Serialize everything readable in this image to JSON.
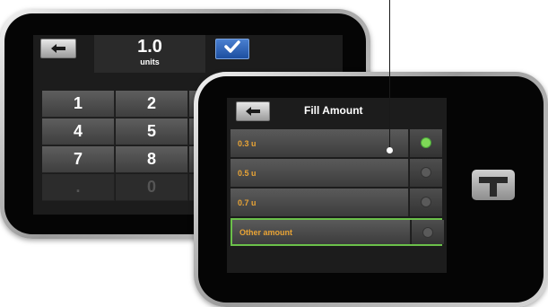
{
  "units_screen": {
    "value": "1.0",
    "unit_label": "units",
    "keypad": [
      {
        "label": "1",
        "dim": false
      },
      {
        "label": "2",
        "dim": false
      },
      {
        "label": "4",
        "dim": false
      },
      {
        "label": "5",
        "dim": false
      },
      {
        "label": "7",
        "dim": false
      },
      {
        "label": "8",
        "dim": false
      },
      {
        "label": ".",
        "dim": true
      },
      {
        "label": "0",
        "dim": true
      }
    ]
  },
  "fill_screen": {
    "title": "Fill Amount",
    "options": [
      {
        "label": "0.3 u",
        "selected": true,
        "highlighted": false
      },
      {
        "label": "0.5 u",
        "selected": false,
        "highlighted": false
      },
      {
        "label": "0.7 u",
        "selected": false,
        "highlighted": false
      },
      {
        "label": "Other amount",
        "selected": false,
        "highlighted": true
      }
    ]
  },
  "icons": {
    "back": "back-arrow-icon",
    "confirm": "checkmark-icon",
    "brand": "t-logo-icon"
  },
  "colors": {
    "option_text": "#e8a335",
    "selected_radio": "#7ed957",
    "highlight_border": "#6bc04a",
    "confirm_button": "#2a5fb5"
  }
}
